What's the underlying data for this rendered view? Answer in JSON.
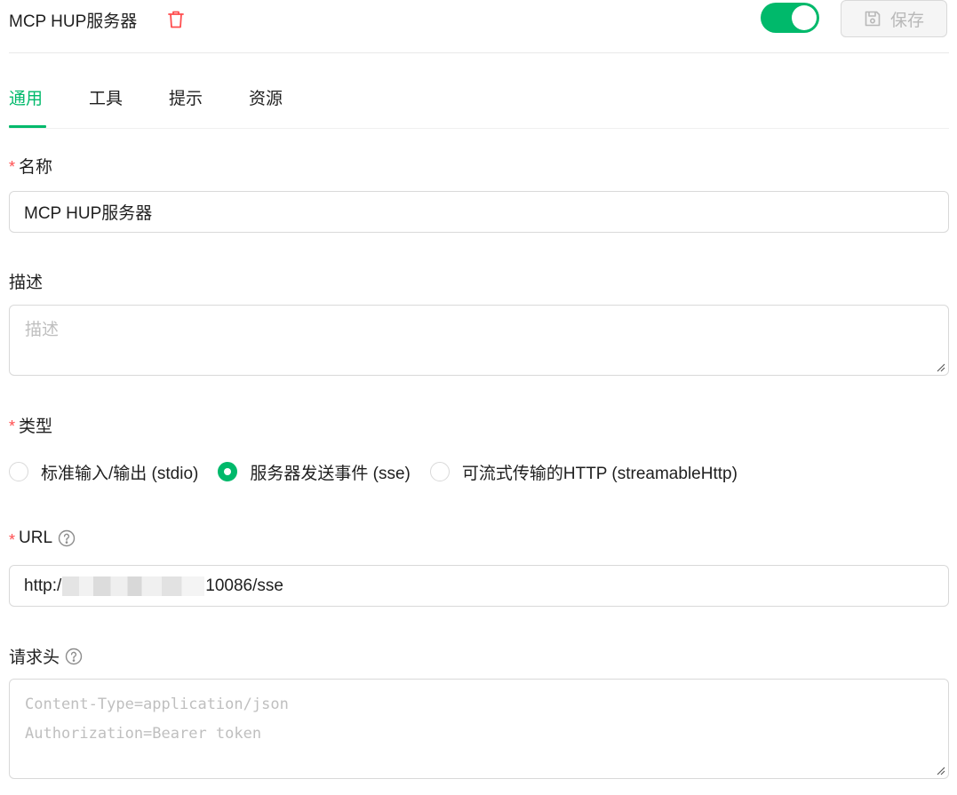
{
  "header": {
    "title": "MCP HUP服务器",
    "delete_icon": "trash-icon",
    "enabled": true,
    "save_label": "保存",
    "save_icon": "save-icon"
  },
  "tabs": [
    {
      "label": "通用",
      "active": true
    },
    {
      "label": "工具",
      "active": false
    },
    {
      "label": "提示",
      "active": false
    },
    {
      "label": "资源",
      "active": false
    }
  ],
  "form": {
    "name": {
      "label": "名称",
      "required": true,
      "value": "MCP HUP服务器"
    },
    "description": {
      "label": "描述",
      "required": false,
      "placeholder": "描述"
    },
    "type": {
      "label": "类型",
      "required": true,
      "options": [
        {
          "label": "标准输入/输出 (stdio)",
          "selected": false
        },
        {
          "label": "服务器发送事件 (sse)",
          "selected": true
        },
        {
          "label": "可流式传输的HTTP (streamableHttp)",
          "selected": false
        }
      ]
    },
    "url": {
      "label": "URL",
      "required": true,
      "value_prefix": "http:/",
      "value_suffix": "10086/sse",
      "help_icon": "question-circle-icon"
    },
    "headers": {
      "label": "请求头",
      "required": false,
      "help_icon": "question-circle-icon",
      "placeholder_line1": "Content-Type=application/json",
      "placeholder_line2": "Authorization=Bearer token"
    }
  },
  "colors": {
    "accent": "#00b96b",
    "required": "#ff4d4f",
    "danger": "#ff4d4f"
  }
}
